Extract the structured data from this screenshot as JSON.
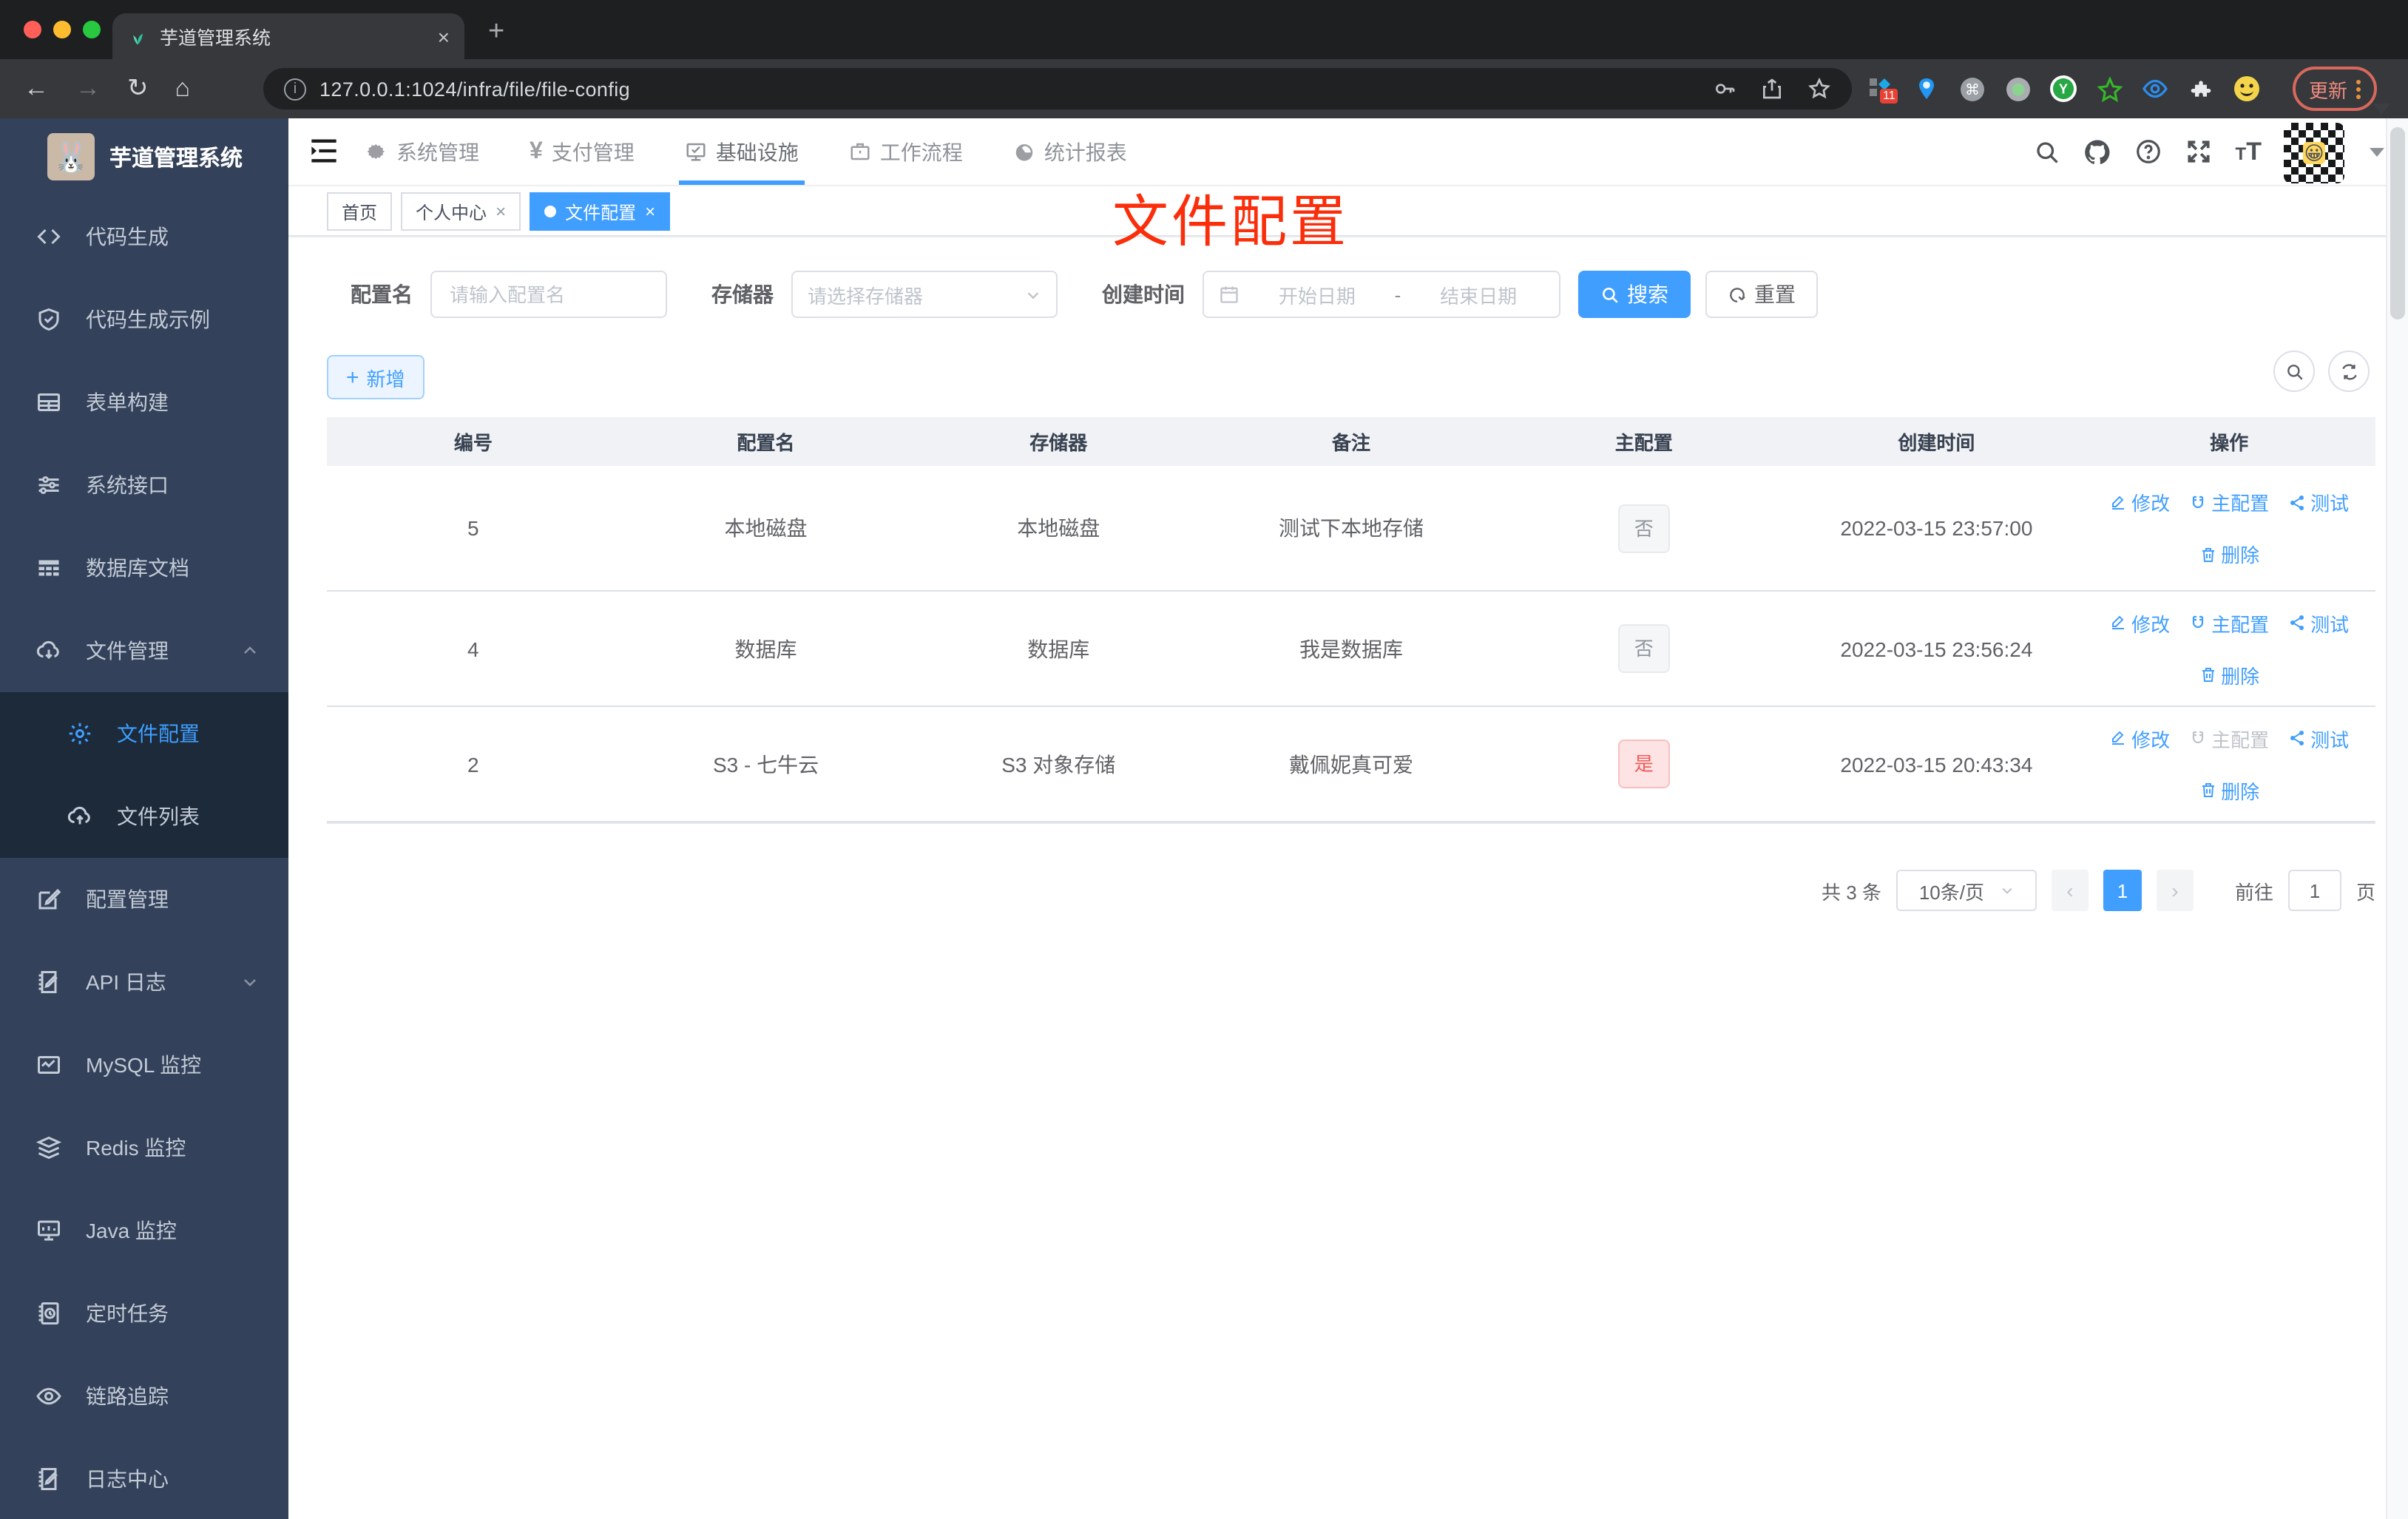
{
  "browser": {
    "tab_title": "芋道管理系统",
    "url": "127.0.0.1:1024/infra/file/file-config",
    "new_tab": "+",
    "close_tab": "×",
    "update_label": "更新",
    "extension_badge": "11"
  },
  "sidebar": {
    "logo_title": "芋道管理系统",
    "items": [
      {
        "label": "代码生成",
        "icon": "code-icon"
      },
      {
        "label": "代码生成示例",
        "icon": "shield-check-icon"
      },
      {
        "label": "表单构建",
        "icon": "form-icon"
      },
      {
        "label": "系统接口",
        "icon": "sliders-icon"
      },
      {
        "label": "数据库文档",
        "icon": "db-table-icon"
      },
      {
        "label": "文件管理",
        "icon": "cloud-download-icon",
        "expanded": true,
        "children": [
          {
            "label": "文件配置",
            "icon": "gear-icon",
            "active": true
          },
          {
            "label": "文件列表",
            "icon": "cloud-upload-icon"
          }
        ]
      },
      {
        "label": "配置管理",
        "icon": "edit-square-icon"
      },
      {
        "label": "API 日志",
        "icon": "doc-edit-icon",
        "collapsible": true
      },
      {
        "label": "MySQL 监控",
        "icon": "chart-icon"
      },
      {
        "label": "Redis 监控",
        "icon": "layers-icon"
      },
      {
        "label": "Java 监控",
        "icon": "monitor-icon"
      },
      {
        "label": "定时任务",
        "icon": "schedule-icon"
      },
      {
        "label": "链路追踪",
        "icon": "eye-icon"
      },
      {
        "label": "日志中心",
        "icon": "log-icon"
      }
    ]
  },
  "topnav": {
    "items": [
      {
        "label": "系统管理",
        "icon": "gear-icon"
      },
      {
        "label": "支付管理",
        "icon": "yen-icon"
      },
      {
        "label": "基础设施",
        "icon": "infra-icon",
        "active": true
      },
      {
        "label": "工作流程",
        "icon": "briefcase-icon"
      },
      {
        "label": "统计报表",
        "icon": "gauge-icon"
      }
    ]
  },
  "tags": [
    {
      "label": "首页",
      "closable": false,
      "active": false
    },
    {
      "label": "个人中心",
      "closable": true,
      "active": false
    },
    {
      "label": "文件配置",
      "closable": true,
      "active": true
    }
  ],
  "annotation": "文件配置",
  "filter": {
    "config_name_label": "配置名",
    "config_name_placeholder": "请输入配置名",
    "storage_label": "存储器",
    "storage_placeholder": "请选择存储器",
    "create_time_label": "创建时间",
    "start_placeholder": "开始日期",
    "range_separator": "-",
    "end_placeholder": "结束日期",
    "search_label": "搜索",
    "reset_label": "重置"
  },
  "toolbar": {
    "add_label": "新增"
  },
  "table": {
    "columns": [
      "编号",
      "配置名",
      "存储器",
      "备注",
      "主配置",
      "创建时间",
      "操作"
    ],
    "actions": {
      "edit": "修改",
      "master": "主配置",
      "test": "测试",
      "delete": "删除"
    },
    "rows": [
      {
        "id": "5",
        "name": "本地磁盘",
        "storage": "本地磁盘",
        "remark": "测试下本地存储",
        "master": "否",
        "master_state": "no",
        "time": "2022-03-15 23:57:00",
        "master_action_disabled": false
      },
      {
        "id": "4",
        "name": "数据库",
        "storage": "数据库",
        "remark": "我是数据库",
        "master": "否",
        "master_state": "no",
        "time": "2022-03-15 23:56:24",
        "master_action_disabled": false
      },
      {
        "id": "2",
        "name": "S3 - 七牛云",
        "storage": "S3 对象存储",
        "remark": "戴佩妮真可爱",
        "master": "是",
        "master_state": "yes",
        "time": "2022-03-15 20:43:34",
        "master_action_disabled": true
      }
    ]
  },
  "pagination": {
    "total_text": "共 3 条",
    "page_size": "10条/页",
    "prev": "‹",
    "current_page": "1",
    "next": "›",
    "goto_label": "前往",
    "goto_value": "1",
    "page_suffix": "页"
  },
  "colors": {
    "accent": "#409eff",
    "danger": "#f56c6c",
    "annotation_red": "#fb2e0c",
    "sidebar_bg": "#33415a",
    "submenu_bg": "#1c2a3a"
  }
}
